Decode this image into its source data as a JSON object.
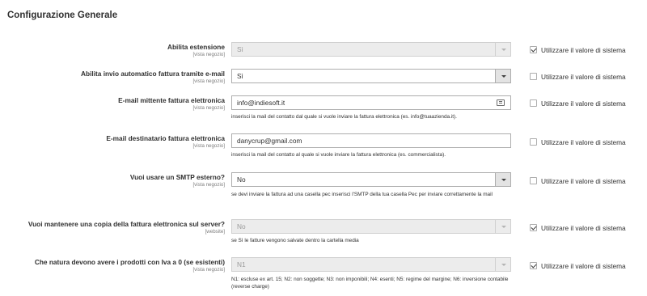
{
  "section": {
    "title": "Configurazione Generale"
  },
  "rows": [
    {
      "label": "Abilita estensione",
      "scope": "[vista negozio]",
      "value": "Sì",
      "note": "",
      "use_system": true,
      "system_label": "Utilizzare il valore di sistema"
    },
    {
      "label": "Abilita invio automatico fattura tramite e-mail",
      "scope": "[vista negozio]",
      "value": "Sì",
      "note": "",
      "use_system": false,
      "system_label": "Utilizzare il valore di sistema"
    },
    {
      "label": "E-mail mittente fattura elettronica",
      "scope": "[vista negozio]",
      "value": "info@indiesoft.it",
      "note": "inserisci la mail del contatto dal quale si vuole inviare la fattura elettronica (es. info@tuaazienda.it).",
      "use_system": false,
      "system_label": "Utilizzare il valore di sistema"
    },
    {
      "label": "E-mail destinatario fattura elettronica",
      "scope": "[vista negozio]",
      "value": "danycrup@gmail.com",
      "note": "inserisci la mail del contatto al quale si vuole inviare la fattura elettronica (es. commercialista).",
      "use_system": false,
      "system_label": "Utilizzare il valore di sistema"
    },
    {
      "label": "Vuoi usare un SMTP esterno?",
      "scope": "[vista negozio]",
      "value": "No",
      "note": "se devi inviare la fattura ad una casella pec inserisci l'SMTP della tua casella Pec per inviare correttamente la mail",
      "use_system": false,
      "system_label": "Utilizzare il valore di sistema"
    },
    {
      "label": "Vuoi mantenere una copia della fattura elettronica sul server?",
      "scope": "[website]",
      "value": "No",
      "note": "se Sì le fatture vengono salvate dentro la cartella media",
      "use_system": true,
      "system_label": "Utilizzare il valore di sistema"
    },
    {
      "label": "Che natura devono avere i prodotti con Iva a 0 (se esistenti)",
      "scope": "[vista negozio]",
      "value": "N1",
      "note": "N1: escluse ex art. 15; N2: non soggette; N3: non imponibili; N4: esenti; N5: regime del margine; N6: inversione contabile (reverse charge)",
      "use_system": true,
      "system_label": "Utilizzare il valore di sistema"
    }
  ]
}
